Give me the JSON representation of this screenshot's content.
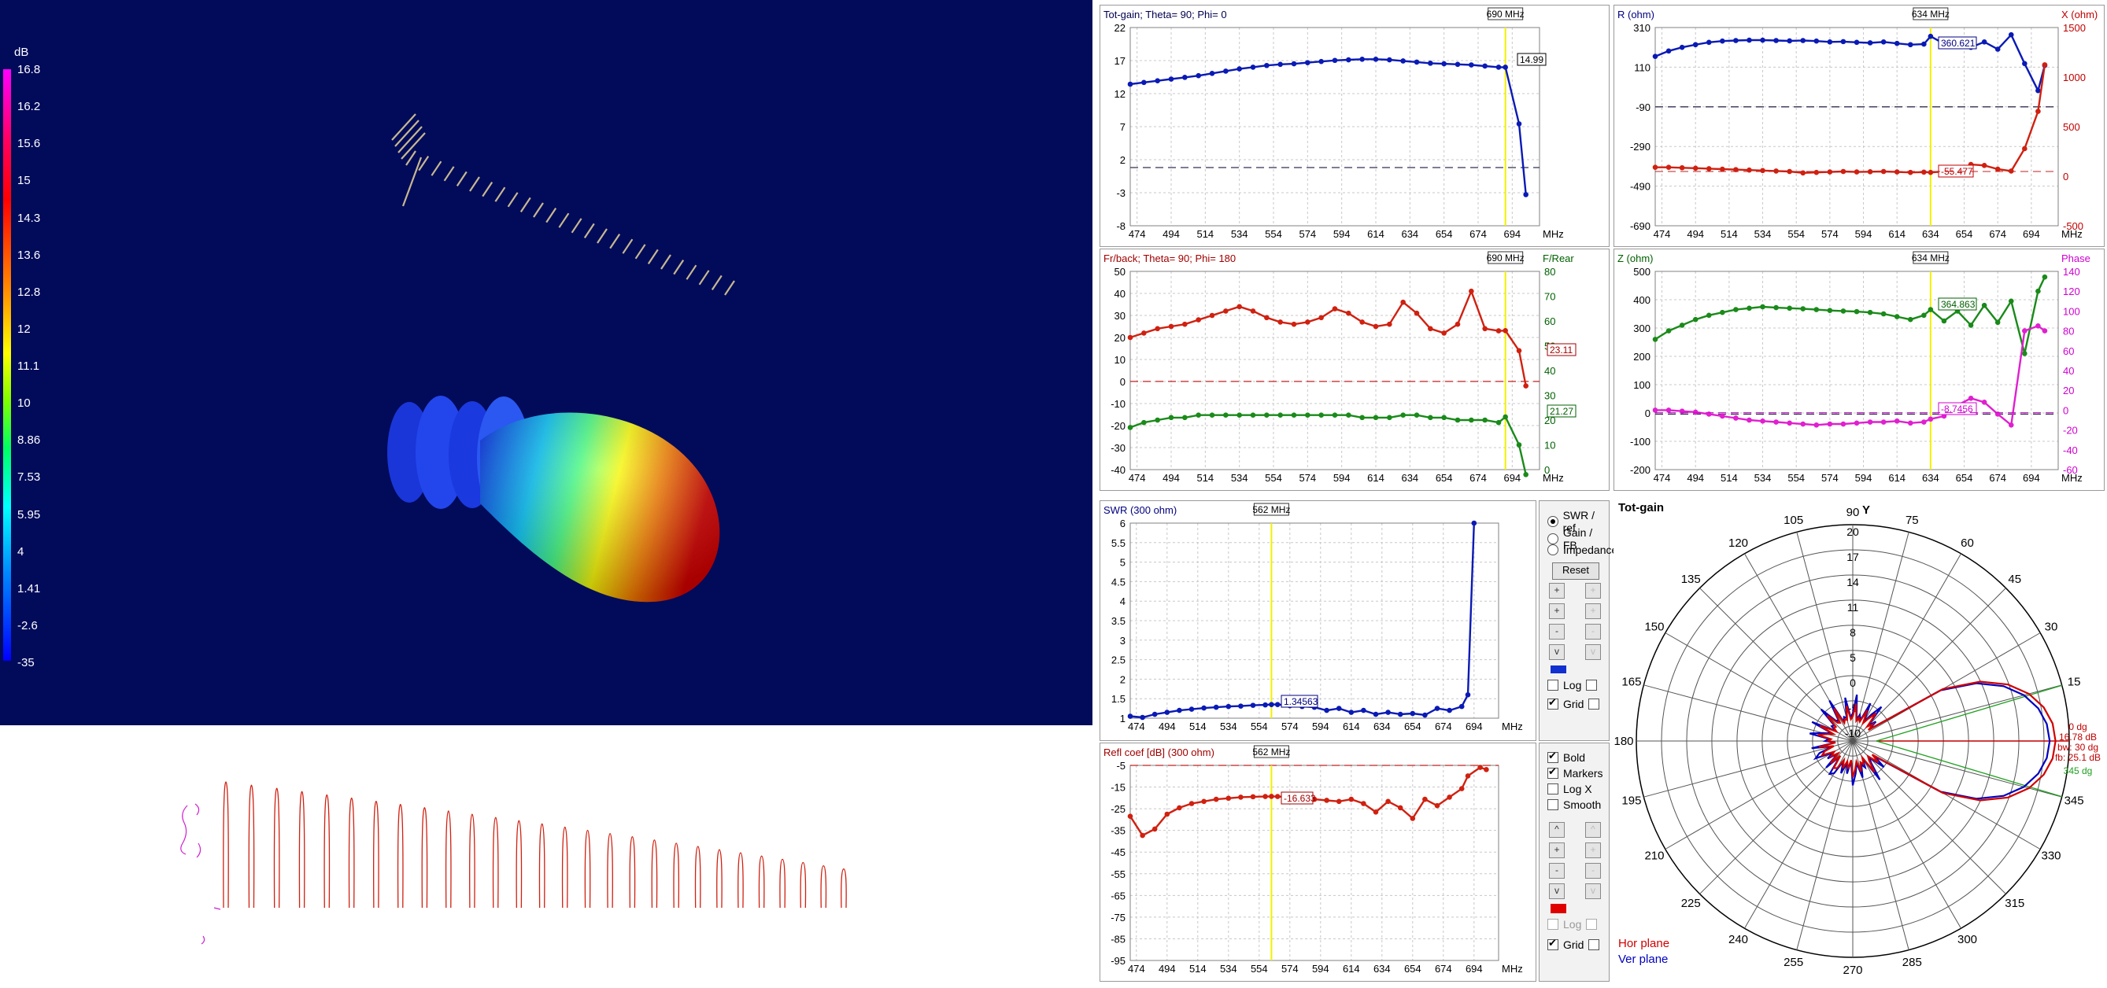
{
  "colors": {
    "background_3d": "#020a5a",
    "gain_line": "#0a1ab4",
    "r_line": "#0a1ab4",
    "x_line": "#d02010",
    "frback_line": "#d02010",
    "rear_line": "#1a8a1a",
    "z_line": "#1a8a1a",
    "phase_line": "#e020d0",
    "swr_line": "#0a1ab4",
    "refl_line": "#d02010",
    "marker_line": "#f0f000",
    "hor_plane": "#d00000",
    "ver_plane": "#0000c0",
    "gainfb_swatch": "#1030d0",
    "refl_swatch": "#e00000"
  },
  "colorbar": {
    "unit": "dB",
    "labels": [
      "16.8",
      "16.2",
      "15.6",
      "15",
      "14.3",
      "13.6",
      "12.8",
      "12",
      "11.1",
      "10",
      "8.86",
      "7.53",
      "5.95",
      "4",
      "1.41",
      "-2.6",
      "-35"
    ]
  },
  "x_ticks": [
    "474",
    "494",
    "514",
    "534",
    "554",
    "574",
    "594",
    "614",
    "634",
    "654",
    "674",
    "694"
  ],
  "x_unit": "MHz",
  "charts": {
    "gain": {
      "title": "Tot-gain; Theta= 90; Phi= 0",
      "y_ticks": [
        "22",
        "17",
        "12",
        "7",
        "2",
        "-3",
        "-8"
      ],
      "marker": "690 MHz",
      "value_label": "14.99"
    },
    "impedance": {
      "title_left": "R (ohm)",
      "title_right": "X (ohm)",
      "y_ticks_left": [
        "310",
        "110",
        "-90",
        "-290",
        "-490",
        "-690"
      ],
      "y_ticks_right": [
        "1500",
        "1000",
        "500",
        "0",
        "-500"
      ],
      "marker": "634 MHz",
      "value_r": "360.621",
      "value_x": "-55.477"
    },
    "frback": {
      "title": "Fr/back; Theta= 90; Phi= 180",
      "title_right": "F/Rear",
      "y_ticks_left": [
        "50",
        "40",
        "30",
        "20",
        "10",
        "0",
        "-10",
        "-20",
        "-30",
        "-40"
      ],
      "y_ticks_right": [
        "80",
        "70",
        "60",
        "50",
        "40",
        "30",
        "20",
        "10",
        "0"
      ],
      "marker": "690 MHz",
      "value_fb": "23.11",
      "value_rear": "21.27"
    },
    "zphase": {
      "title_left": "Z (ohm)",
      "title_right": "Phase",
      "y_ticks_left": [
        "500",
        "400",
        "300",
        "200",
        "100",
        "0",
        "-100",
        "-200"
      ],
      "y_ticks_right": [
        "140",
        "120",
        "100",
        "80",
        "60",
        "40",
        "20",
        "0",
        "-20",
        "-40",
        "-60"
      ],
      "marker": "634 MHz",
      "value_z": "364.863",
      "value_phase": "-8.7456"
    },
    "swr": {
      "title": "SWR (300 ohm)",
      "y_ticks": [
        "6",
        "5.5",
        "5",
        "4.5",
        "4",
        "3.5",
        "3",
        "2.5",
        "2",
        "1.5",
        "1"
      ],
      "marker": "562 MHz",
      "value_label": "1.34563"
    },
    "refl": {
      "title": "Refl coef [dB] (300 ohm)",
      "y_ticks": [
        "-5",
        "-15",
        "-25",
        "-35",
        "-45",
        "-55",
        "-65",
        "-75",
        "-85",
        "-95"
      ],
      "marker": "562 MHz",
      "value_label": "-16.633"
    }
  },
  "chart_data": [
    {
      "type": "line",
      "title": "Tot-gain; Theta= 90; Phi= 0",
      "xlabel": "MHz",
      "xlim": [
        470,
        710
      ],
      "ylim": [
        -10,
        22
      ],
      "x": [
        470,
        478,
        486,
        494,
        502,
        510,
        518,
        526,
        534,
        542,
        550,
        558,
        566,
        574,
        582,
        590,
        598,
        606,
        614,
        622,
        630,
        638,
        646,
        654,
        662,
        670,
        678,
        686,
        690,
        698,
        702
      ],
      "series": [
        {
          "name": "Tot-gain",
          "values": [
            12.0,
            12.3,
            12.6,
            12.9,
            13.2,
            13.5,
            13.9,
            14.3,
            14.7,
            15.0,
            15.3,
            15.5,
            15.6,
            15.8,
            16.0,
            16.2,
            16.3,
            16.4,
            16.4,
            16.3,
            16.1,
            15.9,
            15.7,
            15.6,
            15.5,
            15.4,
            15.2,
            15.0,
            14.99,
            5.0,
            -7.5
          ]
        }
      ]
    },
    {
      "type": "line",
      "title": "R (ohm) / X (ohm)",
      "xlabel": "MHz",
      "xlim": [
        470,
        710
      ],
      "ylim_left": [
        -690,
        410
      ],
      "ylim_right": [
        -500,
        1500
      ],
      "x": [
        470,
        478,
        486,
        494,
        502,
        510,
        518,
        526,
        534,
        542,
        550,
        558,
        566,
        574,
        582,
        590,
        598,
        606,
        614,
        622,
        630,
        634,
        642,
        650,
        658,
        666,
        674,
        682,
        690,
        698,
        702
      ],
      "series": [
        {
          "name": "R (ohm)",
          "axis": "left",
          "values": [
            250,
            280,
            300,
            315,
            328,
            335,
            338,
            340,
            340,
            338,
            336,
            338,
            335,
            330,
            332,
            328,
            325,
            330,
            322,
            315,
            318,
            361,
            320,
            345,
            300,
            330,
            290,
            370,
            210,
            60,
            200
          ]
        },
        {
          "name": "X (ohm)",
          "axis": "right",
          "values": [
            0,
            0,
            -5,
            -10,
            -15,
            -20,
            -25,
            -30,
            -35,
            -40,
            -45,
            -60,
            -55,
            -50,
            -45,
            -50,
            -48,
            -45,
            -50,
            -55,
            -52,
            -55,
            -45,
            -40,
            30,
            20,
            -20,
            -40,
            200,
            600,
            1100
          ]
        }
      ]
    },
    {
      "type": "line",
      "title": "Fr/back; Theta= 90; Phi= 180",
      "xlabel": "MHz",
      "xlim": [
        470,
        710
      ],
      "ylim_left": [
        -45,
        50
      ],
      "ylim_right": [
        0,
        80
      ],
      "x": [
        470,
        478,
        486,
        494,
        502,
        510,
        518,
        526,
        534,
        542,
        550,
        558,
        566,
        574,
        582,
        590,
        598,
        606,
        614,
        622,
        630,
        638,
        646,
        654,
        662,
        670,
        678,
        686,
        690,
        698,
        702
      ],
      "series": [
        {
          "name": "Fr/back",
          "axis": "left",
          "values": [
            20,
            22,
            24,
            25,
            26,
            28,
            30,
            32,
            34,
            32,
            29,
            27,
            26,
            27,
            29,
            33,
            31,
            27,
            25,
            26,
            36,
            31,
            24,
            22,
            26,
            41,
            24,
            23,
            23.11,
            14,
            -2
          ]
        },
        {
          "name": "F/Rear",
          "axis": "right",
          "values": [
            17,
            19,
            20,
            21,
            21,
            22,
            22,
            22,
            22,
            22,
            22,
            22,
            22,
            22,
            22,
            22,
            22,
            21,
            21,
            21,
            22,
            22,
            21,
            21,
            20,
            20,
            20,
            19,
            21.27,
            10,
            -2
          ]
        }
      ]
    },
    {
      "type": "line",
      "title": "Z (ohm) / Phase",
      "xlabel": "MHz",
      "xlim": [
        470,
        710
      ],
      "ylim_left": [
        -200,
        500
      ],
      "ylim_right": [
        -60,
        140
      ],
      "x": [
        470,
        478,
        486,
        494,
        502,
        510,
        518,
        526,
        534,
        542,
        550,
        558,
        566,
        574,
        582,
        590,
        598,
        606,
        614,
        622,
        630,
        634,
        642,
        650,
        658,
        666,
        674,
        682,
        690,
        698,
        702
      ],
      "series": [
        {
          "name": "Z (ohm)",
          "axis": "left",
          "values": [
            260,
            290,
            310,
            330,
            345,
            355,
            365,
            370,
            375,
            372,
            370,
            368,
            365,
            362,
            360,
            358,
            355,
            350,
            340,
            330,
            345,
            365,
            325,
            360,
            310,
            380,
            320,
            395,
            210,
            430,
            480
          ]
        },
        {
          "name": "Phase",
          "axis": "right",
          "values": [
            0,
            0,
            -1,
            -2,
            -4,
            -6,
            -8,
            -10,
            -11,
            -12,
            -13,
            -14,
            -15,
            -14,
            -14,
            -13,
            -12,
            -12,
            -11,
            -13,
            -12,
            -9,
            -6,
            5,
            12,
            8,
            -4,
            -15,
            80,
            85,
            80
          ]
        }
      ]
    },
    {
      "type": "line",
      "title": "SWR (300 ohm)",
      "xlabel": "MHz",
      "xlim": [
        470,
        710
      ],
      "ylim": [
        1,
        6
      ],
      "x": [
        470,
        478,
        486,
        494,
        502,
        510,
        518,
        526,
        534,
        542,
        550,
        558,
        562,
        566,
        574,
        582,
        590,
        598,
        606,
        614,
        622,
        630,
        638,
        646,
        654,
        662,
        670,
        678,
        686,
        690,
        694
      ],
      "series": [
        {
          "name": "SWR",
          "values": [
            1.05,
            1.02,
            1.1,
            1.15,
            1.2,
            1.23,
            1.26,
            1.28,
            1.3,
            1.31,
            1.33,
            1.34,
            1.35,
            1.35,
            1.32,
            1.3,
            1.28,
            1.2,
            1.25,
            1.15,
            1.2,
            1.1,
            1.15,
            1.1,
            1.12,
            1.08,
            1.25,
            1.2,
            1.3,
            1.6,
            6.0
          ]
        }
      ]
    },
    {
      "type": "line",
      "title": "Refl coef [dB] (300 ohm)",
      "xlabel": "MHz",
      "xlim": [
        470,
        710
      ],
      "ylim": [
        -95,
        0
      ],
      "x": [
        470,
        478,
        486,
        494,
        502,
        510,
        518,
        526,
        534,
        542,
        550,
        558,
        562,
        566,
        574,
        582,
        590,
        598,
        606,
        614,
        622,
        630,
        638,
        646,
        654,
        662,
        670,
        678,
        686,
        690,
        698,
        702
      ],
      "series": [
        {
          "name": "Refl coef",
          "values": [
            -26,
            -35,
            -32,
            -25,
            -22,
            -20,
            -19,
            -18,
            -17.5,
            -17,
            -16.8,
            -16.7,
            -16.63,
            -16.7,
            -17,
            -17.5,
            -18,
            -18.5,
            -19,
            -18,
            -20,
            -24,
            -19,
            -22,
            -27,
            -18,
            -21,
            -17,
            -13,
            -7,
            -3,
            -4
          ]
        }
      ]
    }
  ],
  "controls_top": {
    "radios": [
      {
        "label": "SWR / ref",
        "checked": true
      },
      {
        "label": "Gain / FB",
        "checked": false
      },
      {
        "label": "Impedance",
        "checked": false
      }
    ],
    "reset": "Reset",
    "steppers": [
      [
        "+",
        "+"
      ],
      [
        "+",
        "+"
      ],
      [
        "-",
        "-"
      ],
      [
        "v",
        "v"
      ]
    ],
    "checks": [
      {
        "label": "Log",
        "checked": false
      },
      {
        "label": "Grid",
        "checked": true
      }
    ]
  },
  "controls_bottom": {
    "checks_top": [
      {
        "label": "Bold",
        "checked": true
      },
      {
        "label": "Markers",
        "checked": true
      },
      {
        "label": "Log X",
        "checked": false
      },
      {
        "label": "Smooth",
        "checked": false
      }
    ],
    "steppers": [
      [
        "^",
        "^"
      ],
      [
        "+",
        "+"
      ],
      [
        "-",
        "-"
      ],
      [
        "v",
        "v"
      ]
    ],
    "checks": [
      {
        "label": "Log",
        "checked": false
      },
      {
        "label": "Grid",
        "checked": true
      }
    ]
  },
  "polar": {
    "title": "Tot-gain",
    "y_label": "Y",
    "radial_labels": [
      "20",
      "17",
      "14",
      "11",
      "8",
      "5",
      "0",
      "-5",
      "-10"
    ],
    "angle_labels": [
      "90",
      "75",
      "60",
      "45",
      "30",
      "15",
      "345",
      "330",
      "315",
      "300",
      "285",
      "270",
      "255",
      "240",
      "225",
      "210",
      "195",
      "180",
      "165",
      "150",
      "135",
      "120",
      "105"
    ],
    "readout": [
      "0 dg",
      "16.78 dB",
      "bw: 30 dg",
      "fb: 25.1 dB"
    ],
    "beam_label": "345 dg",
    "legend_hor": "Hor plane",
    "legend_ver": "Ver plane"
  }
}
